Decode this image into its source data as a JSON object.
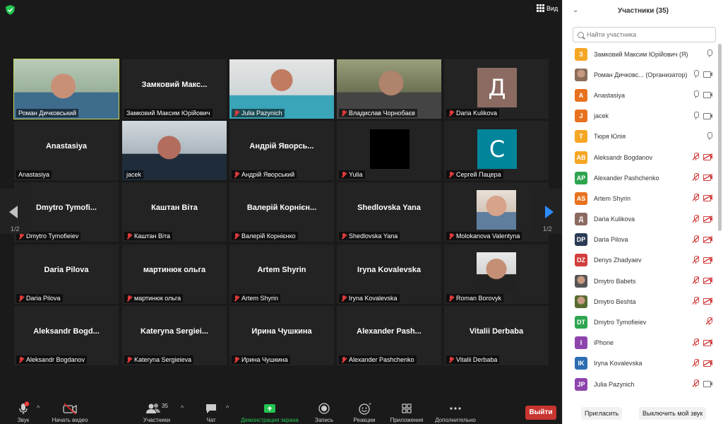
{
  "meeting": {
    "view_label": "Вид",
    "prev_page": "1/2",
    "next_page": "1/2",
    "tiles": [
      {
        "name": "Роман Дичковський",
        "label": "Роман Дичковський",
        "type": "photo",
        "muted": false,
        "active": true
      },
      {
        "name": "Замковий Макс...",
        "label": "Замковий Максим Юрійович",
        "type": "text",
        "muted": false
      },
      {
        "name": "Julia Pazynich",
        "label": "Julia Pazynich",
        "type": "photo",
        "muted": true
      },
      {
        "name": "Владислав Чорнобаєв",
        "label": "Владислав Чорнобаєв",
        "type": "photo",
        "muted": true
      },
      {
        "name": "Daria Kulikova",
        "label": "Daria Kulikova",
        "type": "avatar",
        "letter": "Д",
        "color": "#8b6b61",
        "muted": true
      },
      {
        "name": "Anastasiya",
        "label": "Anastasiya",
        "type": "text",
        "muted": false
      },
      {
        "name": "jacek",
        "label": "jacek",
        "type": "photo",
        "muted": false
      },
      {
        "name": "Андрій Яворсь...",
        "label": "Андрій Яворський",
        "type": "text",
        "muted": true
      },
      {
        "name": "Yulia",
        "label": "Yulia",
        "type": "black",
        "muted": true
      },
      {
        "name": "Сергей Пацера",
        "label": "Сергей Пацера",
        "type": "avatar",
        "letter": "С",
        "color": "#00859a",
        "muted": true
      },
      {
        "name": "Dmytro Tymofi...",
        "label": "Dmytro Tymofieiev",
        "type": "text",
        "muted": true
      },
      {
        "name": "Каштан Віта",
        "label": "Каштан Віта",
        "type": "text",
        "muted": true
      },
      {
        "name": "Валерій Корнієн...",
        "label": "Валерій Корнієнко",
        "type": "text",
        "muted": true
      },
      {
        "name": "Shedlovska Yana",
        "label": "Shedlovska Yana",
        "type": "text",
        "muted": true
      },
      {
        "name": "Molokanova Valentyna",
        "label": "Molokanova Valentyna",
        "type": "photo",
        "muted": true
      },
      {
        "name": "Daria Pilova",
        "label": "Daria Pilova",
        "type": "text",
        "muted": true
      },
      {
        "name": "мартинюк ольга",
        "label": "мартинюк ольга",
        "type": "text",
        "muted": true
      },
      {
        "name": "Artem Shyrin",
        "label": "Artem Shyrin",
        "type": "text",
        "muted": true
      },
      {
        "name": "Iryna Kovalevska",
        "label": "Iryna Kovalevska",
        "type": "text",
        "muted": true
      },
      {
        "name": "Roman Borovyk",
        "label": "Roman Borovyk",
        "type": "photo",
        "muted": true
      },
      {
        "name": "Aleksandr Bogd...",
        "label": "Aleksandr Bogdanov",
        "type": "text",
        "muted": true
      },
      {
        "name": "Kateryna Sergiei...",
        "label": "Kateryna Sergieieva",
        "type": "text",
        "muted": true
      },
      {
        "name": "Ирина Чушкина",
        "label": "Ирина Чушкина",
        "type": "text",
        "muted": true
      },
      {
        "name": "Alexander Pash...",
        "label": "Alexander Pashchenko",
        "type": "text",
        "muted": true
      },
      {
        "name": "Vitalii Derbaba",
        "label": "Vitalii Derbaba",
        "type": "text",
        "muted": true
      }
    ]
  },
  "toolbar": {
    "audio": "Звук",
    "video": "Начать видео",
    "participants": "Участники",
    "participants_count": "35",
    "chat": "Чат",
    "share": "Демонстрация экрана",
    "record": "Запись",
    "reactions": "Реакции",
    "apps": "Приложения",
    "more": "Дополнительно",
    "leave": "Выйти",
    "colors": {
      "share": "#23c552",
      "leave": "#c73531"
    }
  },
  "panel": {
    "title": "Участники (35)",
    "search_placeholder": "Найти участника",
    "invite": "Пригласить",
    "mute_self": "Выключить мой звук",
    "participants": [
      {
        "initials": "З",
        "color": "#f5a623",
        "name": "Замковий Максим Юрійович (Я)",
        "mic": "on",
        "cam": ""
      },
      {
        "initials": "",
        "color": "#8a6d5a",
        "name": "Роман Дичковс... (Организатор)",
        "mic": "on",
        "cam": "on",
        "photo": true
      },
      {
        "initials": "A",
        "color": "#e8711f",
        "name": "Anastasiya",
        "mic": "on",
        "cam": "on"
      },
      {
        "initials": "J",
        "color": "#e8711f",
        "name": "jacek",
        "mic": "on",
        "cam": "on"
      },
      {
        "initials": "Т",
        "color": "#f5a623",
        "name": "Тюря Юлія",
        "mic": "on",
        "cam": ""
      },
      {
        "initials": "AB",
        "color": "#f5a623",
        "name": "Aleksandr Bogdanov",
        "mic": "muted",
        "cam": "muted"
      },
      {
        "initials": "AP",
        "color": "#2ea44f",
        "name": "Alexander Pashchenko",
        "mic": "muted",
        "cam": "muted"
      },
      {
        "initials": "AS",
        "color": "#e8711f",
        "name": "Artem Shyrin",
        "mic": "muted",
        "cam": "muted"
      },
      {
        "initials": "Д",
        "color": "#8b6b61",
        "name": "Daria Kulikova",
        "mic": "muted",
        "cam": "muted"
      },
      {
        "initials": "DP",
        "color": "#2b3b55",
        "name": "Daria Pilova",
        "mic": "muted",
        "cam": "muted"
      },
      {
        "initials": "DZ",
        "color": "#d23d3d",
        "name": "Denys Zhadyaev",
        "mic": "muted",
        "cam": "muted"
      },
      {
        "initials": "",
        "color": "#555555",
        "name": "Dmytro Babets",
        "mic": "muted",
        "cam": "muted",
        "photo": true
      },
      {
        "initials": "",
        "color": "#556b2f",
        "name": "Dmytro Beshta",
        "mic": "muted",
        "cam": "muted",
        "photo": true
      },
      {
        "initials": "DT",
        "color": "#2ea44f",
        "name": "Dmytro Tymofieiev",
        "mic": "muted",
        "cam": ""
      },
      {
        "initials": "I",
        "color": "#8e44ad",
        "name": "iPhone",
        "mic": "muted",
        "cam": "muted"
      },
      {
        "initials": "IK",
        "color": "#2d6db0",
        "name": "Iryna Kovalevska",
        "mic": "muted",
        "cam": "muted"
      },
      {
        "initials": "JP",
        "color": "#8e44ad",
        "name": "Julia Pazynich",
        "mic": "muted",
        "cam": "on"
      }
    ]
  }
}
